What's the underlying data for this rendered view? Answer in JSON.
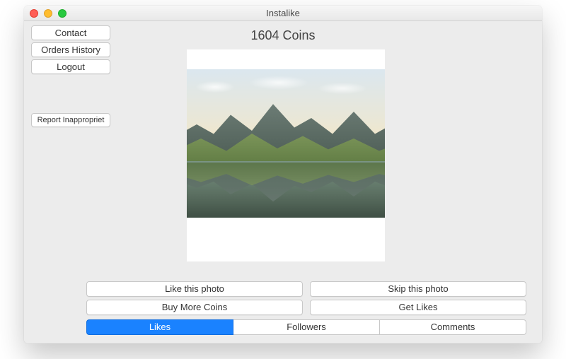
{
  "window": {
    "title": "Instalike"
  },
  "sidebar": {
    "contact": "Contact",
    "orders_history": "Orders History",
    "logout": "Logout",
    "report": "Report Inappropriet"
  },
  "header": {
    "coins_label": "1604 Coins"
  },
  "actions": {
    "like": "Like this photo",
    "skip": "Skip this photo",
    "buy": "Buy More Coins",
    "get_likes": "Get Likes"
  },
  "tabs": {
    "likes": "Likes",
    "followers": "Followers",
    "comments": "Comments",
    "active": "likes"
  },
  "photo": {
    "alt": "landscape-photo"
  }
}
